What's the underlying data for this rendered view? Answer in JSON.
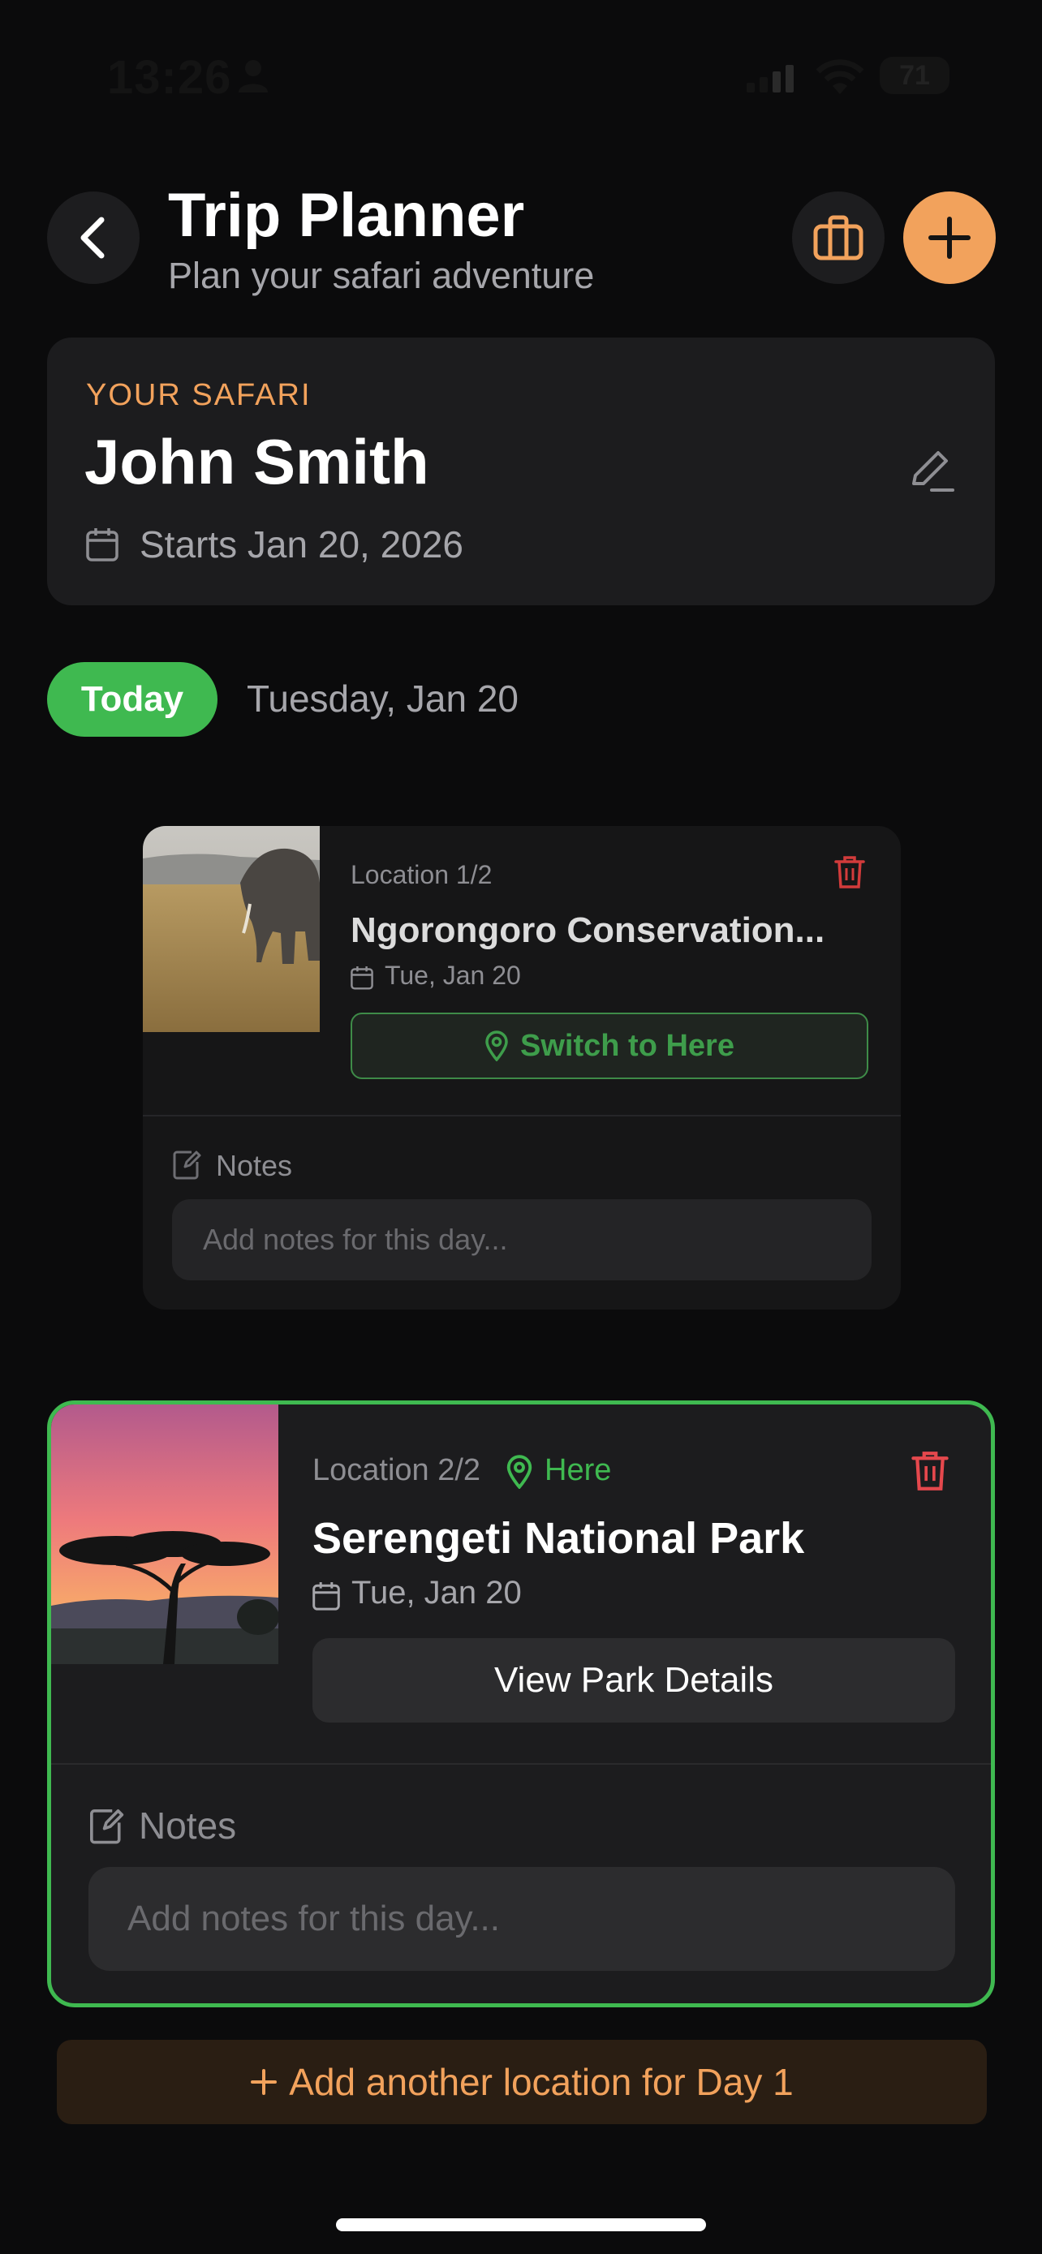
{
  "status_bar": {
    "time": "13:26",
    "battery": "71"
  },
  "header": {
    "title": "Trip Planner",
    "subtitle": "Plan your safari adventure"
  },
  "safari": {
    "label": "YOUR SAFARI",
    "name": "John Smith",
    "start": "Starts Jan 20, 2026"
  },
  "day": {
    "badge": "Today",
    "date": "Tuesday, Jan 20"
  },
  "locations": [
    {
      "label": "Location 1/2",
      "name": "Ngorongoro Conservation...",
      "date": "Tue, Jan 20",
      "action": "Switch to Here",
      "notes_label": "Notes",
      "notes_placeholder": "Add notes for this day..."
    },
    {
      "label": "Location 2/2",
      "here": "Here",
      "name": "Serengeti National Park",
      "date": "Tue, Jan 20",
      "action": "View Park Details",
      "notes_label": "Notes",
      "notes_placeholder": "Add notes for this day..."
    }
  ],
  "add_location": {
    "label": "Add another location for Day 1"
  },
  "colors": {
    "accent": "#f2a25c",
    "success": "#3fb950",
    "danger": "#e5484d",
    "background": "#0b0b0c",
    "card": "#1c1c1e"
  }
}
